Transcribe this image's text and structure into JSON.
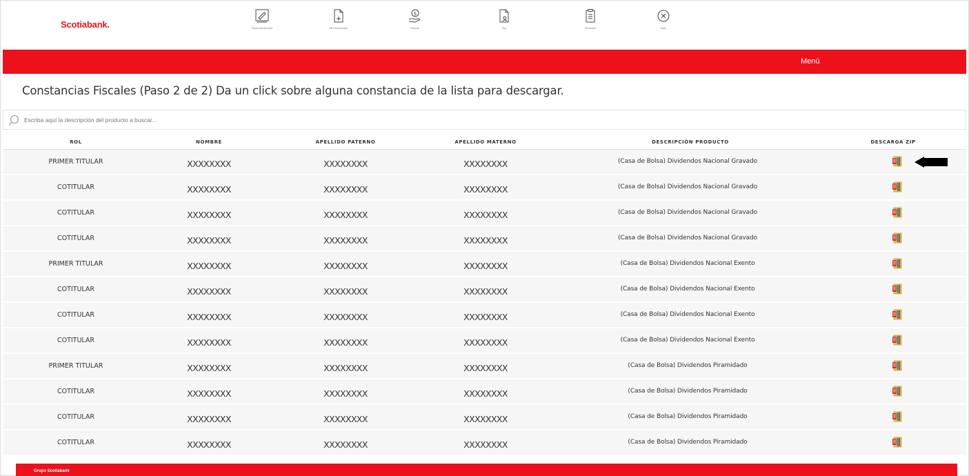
{
  "brand": {
    "name": "Scotiabank.",
    "color": "#ec111a"
  },
  "nav": [
    {
      "icon": "signature-icon",
      "label": "Remuneraciones"
    },
    {
      "icon": "document-add-icon",
      "label": "Mi Información"
    },
    {
      "icon": "money-hand-icon",
      "label": "Fondos"
    },
    {
      "icon": "document-person-icon",
      "label": "Tips"
    },
    {
      "icon": "clipboard-icon",
      "label": "Servicios"
    },
    {
      "icon": "close-circle-icon",
      "label": "Salir"
    }
  ],
  "menu": {
    "label": "Menú"
  },
  "page": {
    "title": "Constancias Fiscales (Paso 2 de 2) Da un click sobre alguna constancia de la lista para descargar."
  },
  "search": {
    "placeholder": "Escriba aquí la descripción del producto a buscar...",
    "value": ""
  },
  "table": {
    "headers": [
      "ROL",
      "NOMBRE",
      "APELLIDO PATERNO",
      "APELLIDO MATERNO",
      "DESCRIPCIÓN PRODUCTO",
      "DESCARGA ZIP"
    ],
    "rows": [
      {
        "rol": "PRIMER TITULAR",
        "nombre": "XXXXXXXX",
        "paterno": "XXXXXXXX",
        "materno": "XXXXXXXX",
        "descripcion": "(Casa de Bolsa) Dividendos Nacional Gravado",
        "zip_icon": "zip-file-icon"
      },
      {
        "rol": "COTITULAR",
        "nombre": "XXXXXXXX",
        "paterno": "XXXXXXXX",
        "materno": "XXXXXXXX",
        "descripcion": "(Casa de Bolsa) Dividendos Nacional Gravado",
        "zip_icon": "zip-file-icon"
      },
      {
        "rol": "COTITULAR",
        "nombre": "XXXXXXXX",
        "paterno": "XXXXXXXX",
        "materno": "XXXXXXXX",
        "descripcion": "(Casa de Bolsa) Dividendos Nacional Gravado",
        "zip_icon": "zip-file-icon"
      },
      {
        "rol": "COTITULAR",
        "nombre": "XXXXXXXX",
        "paterno": "XXXXXXXX",
        "materno": "XXXXXXXX",
        "descripcion": "(Casa de Bolsa) Dividendos Nacional Gravado",
        "zip_icon": "zip-file-icon"
      },
      {
        "rol": "PRIMER TITULAR",
        "nombre": "XXXXXXXX",
        "paterno": "XXXXXXXX",
        "materno": "XXXXXXXX",
        "descripcion": "(Casa de Bolsa) Dividendos Nacional Exento",
        "zip_icon": "zip-file-icon"
      },
      {
        "rol": "COTITULAR",
        "nombre": "XXXXXXXX",
        "paterno": "XXXXXXXX",
        "materno": "XXXXXXXX",
        "descripcion": "(Casa de Bolsa) Dividendos Nacional Exento",
        "zip_icon": "zip-file-icon"
      },
      {
        "rol": "COTITULAR",
        "nombre": "XXXXXXXX",
        "paterno": "XXXXXXXX",
        "materno": "XXXXXXXX",
        "descripcion": "(Casa de Bolsa) Dividendos Nacional Exento",
        "zip_icon": "zip-file-icon"
      },
      {
        "rol": "COTITULAR",
        "nombre": "XXXXXXXX",
        "paterno": "XXXXXXXX",
        "materno": "XXXXXXXX",
        "descripcion": "(Casa de Bolsa) Dividendos Nacional Exento",
        "zip_icon": "zip-file-icon"
      },
      {
        "rol": "PRIMER TITULAR",
        "nombre": "XXXXXXXX",
        "paterno": "XXXXXXXX",
        "materno": "XXXXXXXX",
        "descripcion": "(Casa de Bolsa) Dividendos Piramidado",
        "zip_icon": "zip-file-icon"
      },
      {
        "rol": "COTITULAR",
        "nombre": "XXXXXXXX",
        "paterno": "XXXXXXXX",
        "materno": "XXXXXXXX",
        "descripcion": "(Casa de Bolsa) Dividendos Piramidado",
        "zip_icon": "zip-file-icon"
      },
      {
        "rol": "COTITULAR",
        "nombre": "XXXXXXXX",
        "paterno": "XXXXXXXX",
        "materno": "XXXXXXXX",
        "descripcion": "(Casa de Bolsa) Dividendos Piramidado",
        "zip_icon": "zip-file-icon"
      },
      {
        "rol": "COTITULAR",
        "nombre": "XXXXXXXX",
        "paterno": "XXXXXXXX",
        "materno": "XXXXXXXX",
        "descripcion": "(Casa de Bolsa) Dividendos Piramidado",
        "zip_icon": "zip-file-icon"
      }
    ]
  },
  "footer": {
    "label": "Grupo Scotiabank"
  },
  "annotation": {
    "icon": "pointer-arrow-icon"
  }
}
